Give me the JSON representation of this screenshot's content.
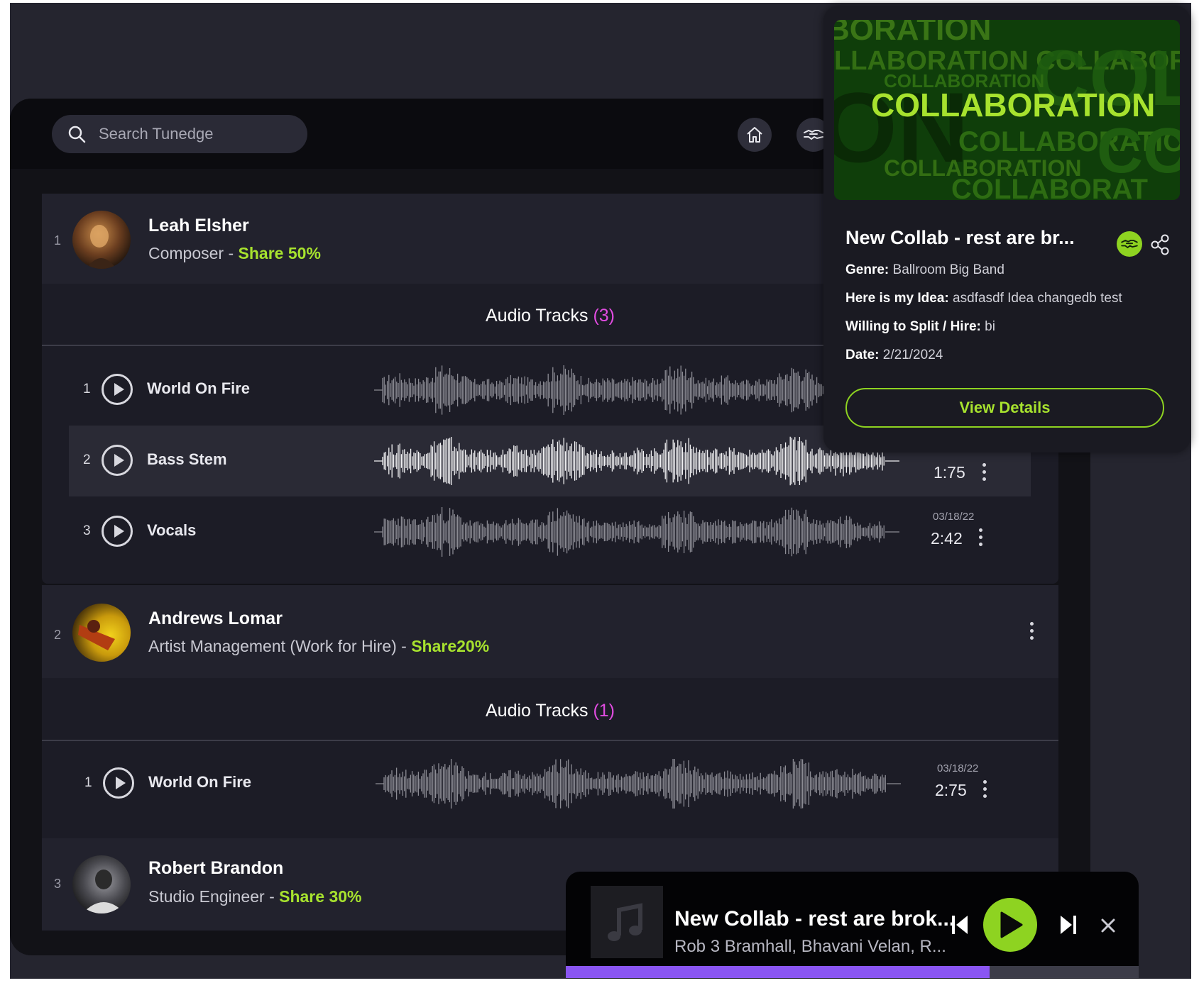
{
  "search": {
    "placeholder": "Search Tunedge"
  },
  "nav": {
    "home_icon": "home-icon",
    "collab_icon": "handshake-icon"
  },
  "members": [
    {
      "index": "1",
      "name": "Leah Elsher",
      "role": "Composer - ",
      "share": "Share 50%",
      "tracks_label": "Audio Tracks",
      "tracks_count": "(3)",
      "tracks": [
        {
          "num": "1",
          "title": "World On Fire",
          "date": "",
          "duration": ""
        },
        {
          "num": "2",
          "title": "Bass Stem",
          "date": "",
          "duration": "1:75"
        },
        {
          "num": "3",
          "title": "Vocals",
          "date": "03/18/22",
          "duration": "2:42"
        }
      ]
    },
    {
      "index": "2",
      "name": "Andrews Lomar",
      "role": "Artist Management (Work for Hire) - ",
      "share": "Share20%",
      "tracks_label": "Audio Tracks",
      "tracks_count": "(1)",
      "tracks": [
        {
          "num": "1",
          "title": "World On Fire",
          "date": "03/18/22",
          "duration": "2:75"
        }
      ]
    },
    {
      "index": "3",
      "name": "Robert Brandon",
      "role": "Studio Engineer - ",
      "share": "Share 30%"
    }
  ],
  "popup": {
    "cover_text": "COLLABORATION",
    "title": "New Collab - rest are br...",
    "genre_label": "Genre:",
    "genre": "Ballroom Big Band",
    "idea_label": "Here is my Idea:",
    "idea": "asdfasdf Idea changedb test",
    "split_label": "Willing to Split / Hire:",
    "split": "bi",
    "date_label": "Date:",
    "date": "2/21/2024",
    "button": "View Details"
  },
  "player": {
    "title": "New Collab - rest are brok...",
    "artists": "Rob 3 Bramhall, Bhavani Velan, R...",
    "progress": 0.74
  },
  "colors": {
    "accent_green": "#a7e22e",
    "count_pink": "#e04ce0",
    "progress_purple": "#8a55f2"
  }
}
